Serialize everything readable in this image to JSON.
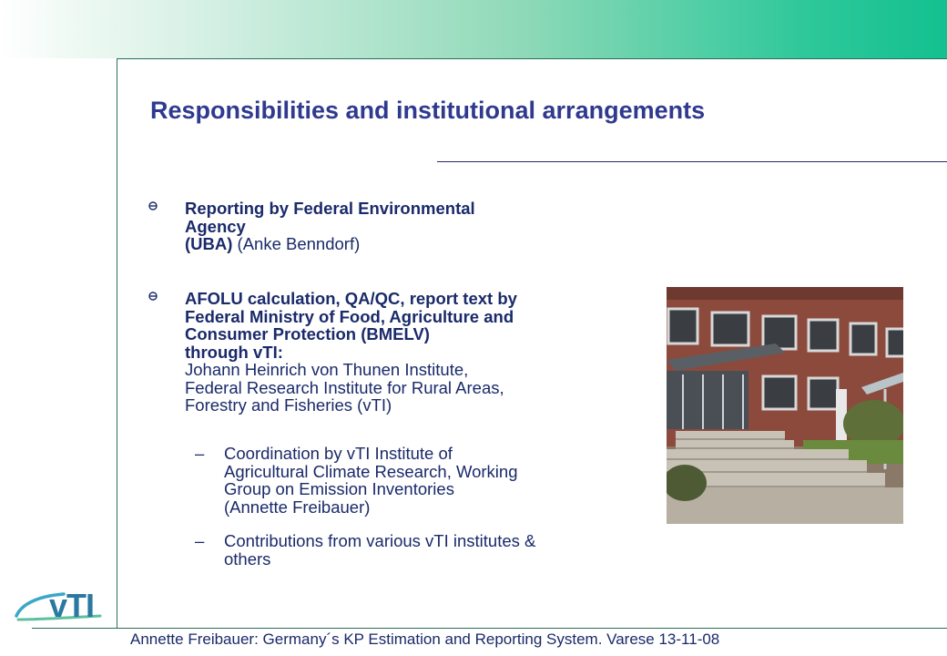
{
  "slide": {
    "title": "Responsibilities and institutional arrangements",
    "bullets": [
      {
        "bold": "Reporting by Federal Environmental Agency (UBA)",
        "bold_line1": "Reporting by Federal Environmental",
        "bold_line2": "Agency",
        "bold_line3": "(UBA)",
        "normal": "(Anke Benndorf)"
      },
      {
        "bold_line1": "AFOLU calculation, QA/QC, report text by",
        "bold_line2": "Federal Ministry of Food, Agriculture and",
        "bold_line3": "Consumer Protection (BMELV)",
        "bold_line4": "through vTI:",
        "normal_line1": "Johann Heinrich von Thunen Institute,",
        "normal_line2": "Federal Research Institute for Rural Areas,",
        "normal_line3": "Forestry and Fisheries (vTI)"
      }
    ],
    "subbullets": [
      {
        "dash": "–",
        "line1": "Coordination by vTI Institute of",
        "line2": "Agricultural Climate Research, Working",
        "line3": "Group on Emission Inventories",
        "line4": "(Annette Freibauer)"
      },
      {
        "dash": "–",
        "line1": "Contributions from various vTI institutes &",
        "line2": "others"
      }
    ]
  },
  "logo": {
    "text": "vTI"
  },
  "footer": {
    "text": "Annette Freibauer: Germany´s KP Estimation and Reporting System. Varese 13-11-08"
  },
  "colors": {
    "title": "#2f3a8f",
    "body": "#1a2a6a",
    "accent_green": "#14c08f",
    "logo": "#2a79a0"
  }
}
